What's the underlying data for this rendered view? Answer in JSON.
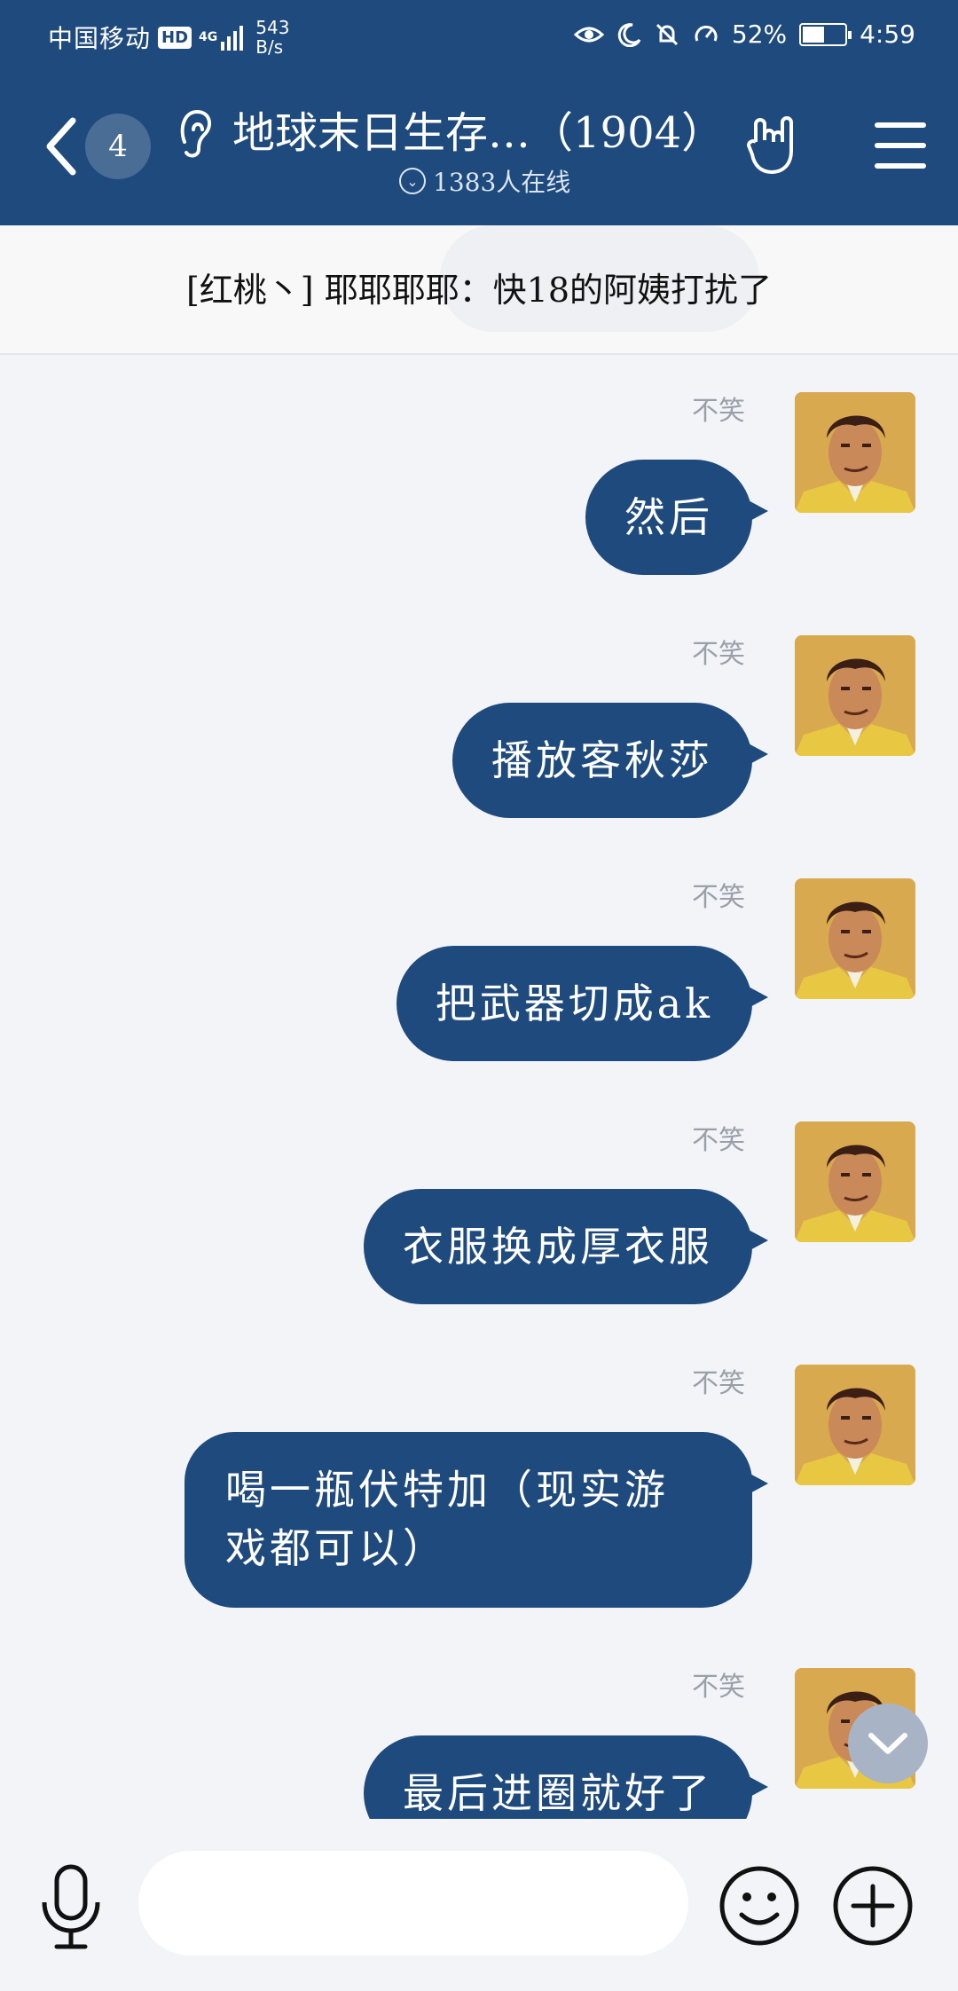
{
  "status_bar": {
    "carrier": "中国移动",
    "hd": "HD",
    "network": "4G",
    "speed_value": "543",
    "speed_unit": "B/s",
    "battery": "52%",
    "battery_level": 0.52,
    "time": "4:59"
  },
  "header": {
    "unread_count": "4",
    "title": "地球末日生存…（1904）",
    "online": "1383人在线"
  },
  "notice": {
    "text": "[红桃丶] 耶耶耶耶：快18的阿姨打扰了"
  },
  "messages": [
    {
      "sender": "不笑",
      "text": "然后"
    },
    {
      "sender": "不笑",
      "text": "播放客秋莎"
    },
    {
      "sender": "不笑",
      "text": "把武器切成ak"
    },
    {
      "sender": "不笑",
      "text": "衣服换成厚衣服"
    },
    {
      "sender": "不笑",
      "text": "喝一瓶伏特加（现实游戏都可以）"
    },
    {
      "sender": "不笑",
      "text": "最后进圈就好了"
    }
  ],
  "input": {
    "placeholder": "",
    "value": ""
  },
  "icons": {
    "back": "back-icon",
    "ear": "ear-icon",
    "rock": "rock-hand-icon",
    "menu": "menu-icon",
    "mic": "mic-icon",
    "emoji": "emoji-icon",
    "plus": "plus-icon",
    "scroll_down": "chevron-down-icon"
  },
  "colors": {
    "primary": "#1e4a7e",
    "background": "#f3f4f8",
    "bubble_text": "#ffffff"
  }
}
